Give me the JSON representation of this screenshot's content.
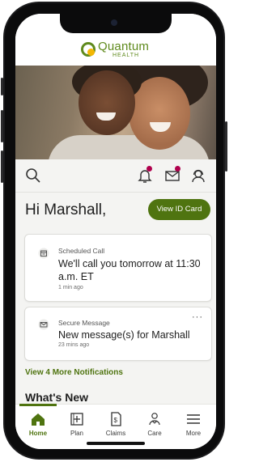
{
  "brand": {
    "name": "Quantum",
    "tagline": "HEALTH",
    "accent_color": "#5f8a1c"
  },
  "hero": {
    "image": "smiling-mother-and-child-photo"
  },
  "toolbar": {
    "icons": [
      "search-icon",
      "bell-icon",
      "mail-icon",
      "user-support-icon"
    ],
    "badge_color": "#b0004d"
  },
  "greeting": "Hi Marshall,",
  "id_card_button": "View ID Card",
  "notifications": [
    {
      "icon": "calendar-icon",
      "kicker": "Scheduled Call",
      "title": "We'll call you tomorrow at 11:30 a.m. ET",
      "time": "1 min ago"
    },
    {
      "icon": "envelope-icon",
      "kicker": "Secure Message",
      "title": "New message(s) for Marshall",
      "time": "23 mins ago",
      "menu": "···"
    }
  ],
  "more_notifications_link": "View 4 More Notifications",
  "section_title": "What's New",
  "tabs": [
    {
      "label": "Home",
      "icon": "home-icon",
      "active": true
    },
    {
      "label": "Plan",
      "icon": "plan-icon",
      "active": false
    },
    {
      "label": "Claims",
      "icon": "claims-icon",
      "active": false
    },
    {
      "label": "Care",
      "icon": "care-icon",
      "active": false
    },
    {
      "label": "More",
      "icon": "hamburger-menu-icon",
      "active": false
    }
  ]
}
